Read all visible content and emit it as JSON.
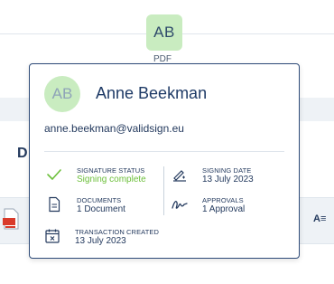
{
  "background": {
    "avatar_initials": "AB",
    "avatar_label": "PDF",
    "heading": "D",
    "sort_icon": "A≡"
  },
  "popover": {
    "initials": "AB",
    "name": "Anne Beekman",
    "email": "anne.beekman@validsign.eu",
    "signature_status": {
      "label": "SIGNATURE STATUS",
      "value": "Signing complete",
      "icon": "check-icon",
      "color": "#6cbf3a"
    },
    "signing_date": {
      "label": "SIGNING DATE",
      "value": "13 July 2023",
      "icon": "signing-pen-icon"
    },
    "documents": {
      "label": "DOCUMENTS",
      "value": "1 Document",
      "icon": "document-icon"
    },
    "approvals": {
      "label": "APPROVALS",
      "value": "1 Approval",
      "icon": "signature-icon"
    },
    "transaction_created": {
      "label": "TRANSACTION CREATED",
      "value": "13 July 2023",
      "icon": "calendar-icon"
    }
  }
}
